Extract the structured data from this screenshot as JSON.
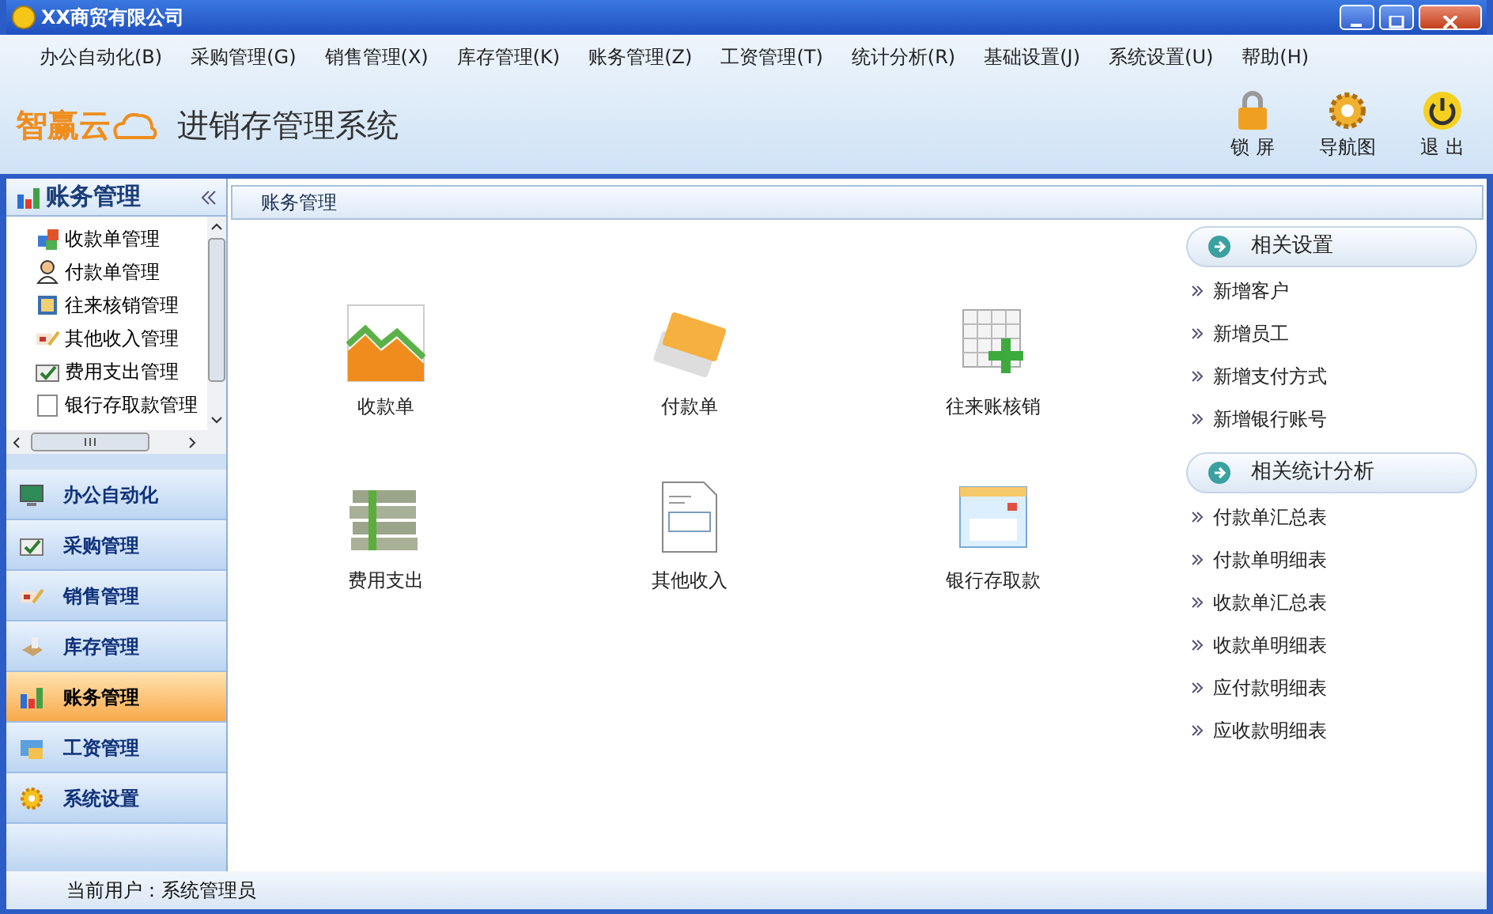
{
  "window": {
    "title": "XX商贸有限公司"
  },
  "menu": [
    "办公自动化(B)",
    "采购管理(G)",
    "销售管理(X)",
    "库存管理(K)",
    "账务管理(Z)",
    "工资管理(T)",
    "统计分析(R)",
    "基础设置(J)",
    "系统设置(U)",
    "帮助(H)"
  ],
  "app": {
    "logo": "智赢云",
    "title": "进销存管理系统"
  },
  "toolbar": [
    {
      "label": "锁 屏",
      "kind": "lock"
    },
    {
      "label": "导航图",
      "kind": "gear"
    },
    {
      "label": "退 出",
      "kind": "power"
    }
  ],
  "sidebar": {
    "title": "账务管理",
    "tree": [
      {
        "label": "收款单管理",
        "kind": "cubes"
      },
      {
        "label": "付款单管理",
        "kind": "person"
      },
      {
        "label": "往来核销管理",
        "kind": "frame"
      },
      {
        "label": "其他收入管理",
        "kind": "pen"
      },
      {
        "label": "费用支出管理",
        "kind": "check"
      },
      {
        "label": "银行存取款管理",
        "kind": "doc"
      }
    ],
    "nav": [
      {
        "label": "办公自动化",
        "kind": "monitor",
        "selected": false
      },
      {
        "label": "采购管理",
        "kind": "check",
        "selected": false
      },
      {
        "label": "销售管理",
        "kind": "pen",
        "selected": false
      },
      {
        "label": "库存管理",
        "kind": "box",
        "selected": false
      },
      {
        "label": "账务管理",
        "kind": "bars",
        "selected": true
      },
      {
        "label": "工资管理",
        "kind": "card",
        "selected": false
      },
      {
        "label": "系统设置",
        "kind": "gear",
        "selected": false
      }
    ]
  },
  "breadcrumb": "账务管理",
  "tiles": [
    {
      "label": "收款单",
      "kind": "chart"
    },
    {
      "label": "付款单",
      "kind": "cards"
    },
    {
      "label": "往来账核销",
      "kind": "grid"
    },
    {
      "label": "费用支出",
      "kind": "money"
    },
    {
      "label": "其他收入",
      "kind": "doc"
    },
    {
      "label": "银行存取款",
      "kind": "window"
    }
  ],
  "panels": [
    {
      "title": "相关设置",
      "links": [
        "新增客户",
        "新增员工",
        "新增支付方式",
        "新增银行账号"
      ]
    },
    {
      "title": "相关统计分析",
      "links": [
        "付款单汇总表",
        "付款单明细表",
        "收款单汇总表",
        "收款单明细表",
        "应付款明细表",
        "应收款明细表"
      ]
    }
  ],
  "status_bar": "当前用户：系统管理员"
}
